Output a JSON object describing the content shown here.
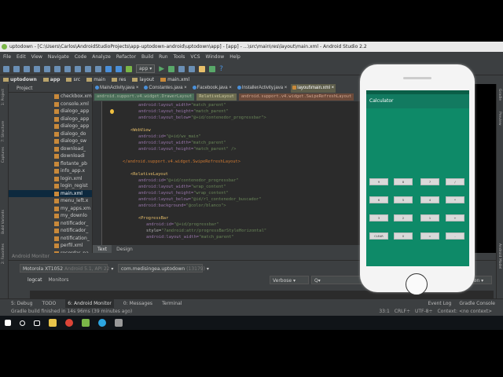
{
  "window": {
    "title": "uptodown - [C:\\Users\\Carlos\\AndroidStudioProjects\\app-uptodown-android\\uptodown\\app] - [app] - ...\\src\\main\\res\\layout\\main.xml - Android Studio 2.2"
  },
  "menu": [
    "File",
    "Edit",
    "View",
    "Navigate",
    "Code",
    "Analyze",
    "Refactor",
    "Build",
    "Run",
    "Tools",
    "VCS",
    "Window",
    "Help"
  ],
  "toolbar": {
    "run_config": "app"
  },
  "breadcrumbs": [
    "uptodown",
    "app",
    "src",
    "main",
    "res",
    "layout",
    "main.xml"
  ],
  "left_strip": [
    "1: Project",
    "7: Structure",
    "Captures",
    "Build Variants",
    "2: Favorites"
  ],
  "right_strip": [
    "Gradle",
    "Preview",
    "Android Model"
  ],
  "project": {
    "header": "Project",
    "files": [
      "checkbox.xml",
      "console.xml",
      "dialogo_app",
      "dialogo_app",
      "dialogo_app",
      "dialogo_do",
      "dialogo_sw",
      "download_",
      "downloadi",
      "flotante_pb",
      "info_app.x",
      "login.xml",
      "login_regist",
      "main.xml",
      "menu_left.x",
      "my_apps.xm",
      "my_downlo",
      "notificador_",
      "notificador_",
      "notification_",
      "perfil.xml",
      "recordar_pa"
    ],
    "selected": 13
  },
  "tabs": [
    {
      "label": "MainActivity.java"
    },
    {
      "label": "Constantes.java"
    },
    {
      "label": "Facebook.java"
    },
    {
      "label": "InstallerActivity.java"
    },
    {
      "label": "layout\\main.xml",
      "active": true
    }
  ],
  "editor": {
    "path": [
      "android.support.v4.widget.DrawerLayout",
      "RelativeLayout",
      "android.support.v4.widget.SwipeRefreshLayout"
    ],
    "lines": [
      [
        "android:layout_width=",
        "\"match_parent\""
      ],
      [
        "android:layout_height=",
        "\"match_parent\""
      ],
      [
        "android:layout_below=",
        "\"@+id/contenedor_progressbar\">"
      ],
      [
        "",
        ""
      ],
      [
        "<WebView",
        ""
      ],
      [
        "android:id=",
        "\"@+id/wv_main\""
      ],
      [
        "android:layout_width=",
        "\"match_parent\""
      ],
      [
        "android:layout_height=",
        "\"match_parent\" />"
      ],
      [
        "",
        ""
      ],
      [
        "</android.support.v4.widget.SwipeRefreshLayout>",
        ""
      ],
      [
        "",
        ""
      ],
      [
        "<RelativeLayout",
        ""
      ],
      [
        "android:id=",
        "\"@+id/contenedor_progressbar\""
      ],
      [
        "android:layout_width=",
        "\"wrap_content\""
      ],
      [
        "android:layout_height=",
        "\"wrap_content\""
      ],
      [
        "android:layout_below=",
        "\"@id/rl_contenedor_buscador\""
      ],
      [
        "android:background=",
        "\"@color/blanco\">"
      ],
      [
        "",
        ""
      ],
      [
        "<ProgressBar",
        ""
      ],
      [
        "android:id=",
        "\"@+id/progressbar\""
      ],
      [
        "style=",
        "\"?android:attr/progressBarStyleHorizontal\""
      ],
      [
        "android:layout_width=",
        "\"match_parent\""
      ]
    ],
    "bottom_tabs": [
      "Text",
      "Design"
    ]
  },
  "monitor": {
    "title": "Android Monitor",
    "device": "Motorola XT1052",
    "device_sub": "Android 5.1, API 22",
    "process": "com.medisingea.uptodown",
    "pid": "(13179)",
    "tabs": [
      "logcat",
      "Monitors"
    ],
    "level": "Verbose",
    "search": "Q▾",
    "filter": "ation"
  },
  "toolwindows": [
    "5: Debug",
    "TODO",
    "6: Android Monitor",
    "0: Messages",
    "Terminal"
  ],
  "toolwindows_right": [
    "Event Log",
    "Gradle Console"
  ],
  "status": {
    "message": "Gradle build finished in 14s 96ms (39 minutes ago)",
    "pos": "33:1",
    "crlf": "CRLF÷",
    "enc": "UTF-8÷",
    "context": "Context: <no context>"
  },
  "phone": {
    "app_title": "Calculator",
    "buttons": [
      [
        "9",
        "8",
        "7",
        "/"
      ],
      [
        "6",
        "5",
        "4",
        "*"
      ],
      [
        "3",
        "2",
        "1",
        "+"
      ],
      [
        "CLEAR",
        "0",
        "=",
        "-"
      ]
    ],
    "colors": {
      "screen": "#0e8a68",
      "appbar": "#127a60"
    }
  }
}
